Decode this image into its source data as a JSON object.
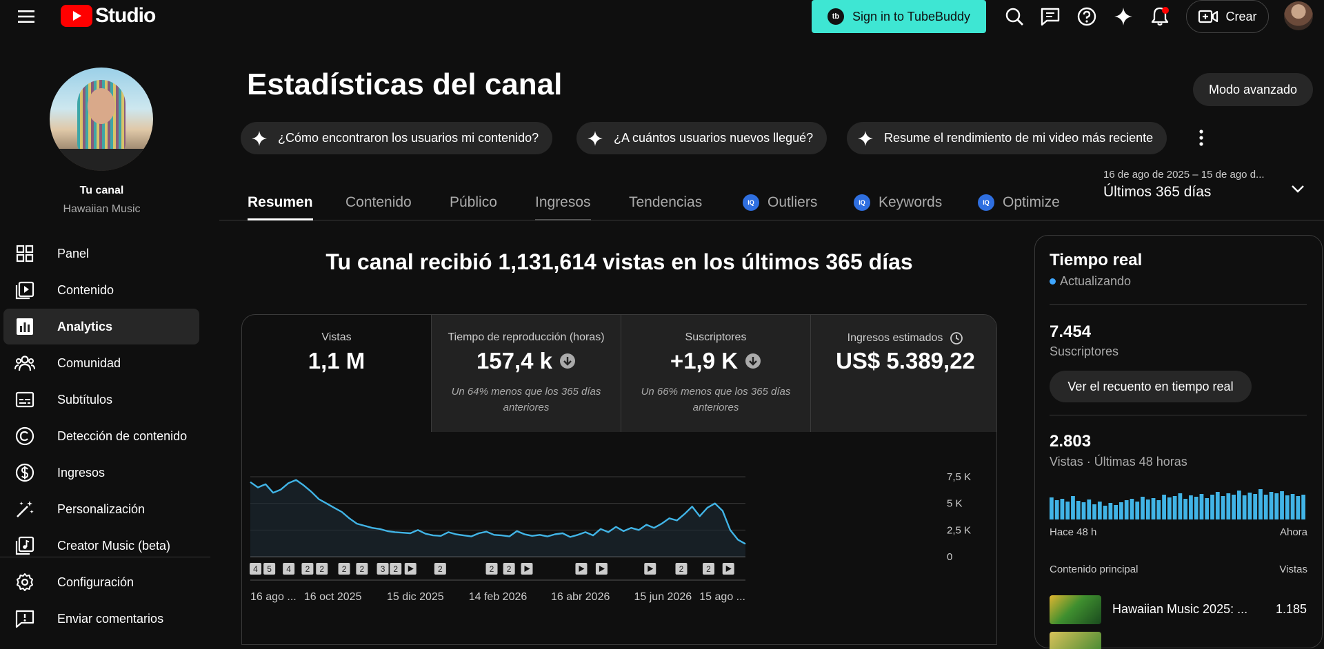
{
  "header": {
    "logo_text": "Studio",
    "tubebuddy_label": "Sign in to TubeBuddy",
    "tubebuddy_logo": "tb",
    "create_label": "Crear",
    "icons": [
      "menu-icon",
      "search-icon",
      "feedback-icon",
      "help-icon",
      "sparkle-icon",
      "bell-icon",
      "video-add-icon"
    ],
    "colors": {
      "tubebuddy": "#3ee6d3",
      "youtube_red": "#ff0000",
      "notification_dot": "#ff0000"
    }
  },
  "sidebar": {
    "channel_label": "Tu canal",
    "channel_name": "Hawaiian Music",
    "items": [
      {
        "label": "Panel",
        "icon": "dashboard-icon"
      },
      {
        "label": "Contenido",
        "icon": "content-icon"
      },
      {
        "label": "Analytics",
        "icon": "analytics-icon",
        "active": true
      },
      {
        "label": "Comunidad",
        "icon": "community-icon"
      },
      {
        "label": "Subtítulos",
        "icon": "subtitles-icon"
      },
      {
        "label": "Detección de contenido",
        "icon": "copyright-icon"
      },
      {
        "label": "Ingresos",
        "icon": "dollar-icon"
      },
      {
        "label": "Personalización",
        "icon": "magic-wand-icon"
      },
      {
        "label": "Creator Music (beta)",
        "icon": "music-icon"
      },
      {
        "label": "Configuración",
        "icon": "settings-icon"
      },
      {
        "label": "Enviar comentarios",
        "icon": "feedback-icon"
      }
    ]
  },
  "page": {
    "title": "Estadísticas del canal",
    "advanced_mode": "Modo avanzado",
    "chips": [
      "¿Cómo encontraron los usuarios mi contenido?",
      "¿A cuántos usuarios nuevos llegué?",
      "Resume el rendimiento de mi video más reciente"
    ],
    "tabs": [
      {
        "label": "Resumen",
        "active": true
      },
      {
        "label": "Contenido"
      },
      {
        "label": "Público"
      },
      {
        "label": "Ingresos"
      },
      {
        "label": "Tendencias"
      },
      {
        "label": "Outliers",
        "badge": "IQ"
      },
      {
        "label": "Keywords",
        "badge": "IQ"
      },
      {
        "label": "Optimize",
        "badge": "IQ"
      }
    ],
    "date_range_detail": "16 de ago de 2025 – 15 de ago d...",
    "date_range_label": "Últimos 365 días",
    "summary": "Tu canal recibió 1,131,614 vistas en los últimos 365 días"
  },
  "metrics": [
    {
      "label": "Vistas",
      "value": "1,1 M",
      "note": ""
    },
    {
      "label": "Tiempo de reproducción (horas)",
      "value": "157,4 k",
      "note": "Un 64% menos que los 365 días anteriores",
      "trend": "down"
    },
    {
      "label": "Suscriptores",
      "value": "+1,9 K",
      "note": "Un 66% menos que los 365 días anteriores",
      "trend": "down"
    },
    {
      "label": "Ingresos estimados",
      "value": "US$ 5.389,22",
      "note": "",
      "icon": "clock-icon"
    }
  ],
  "chart_data": {
    "type": "line",
    "series": [
      {
        "values": [
          7000,
          6500,
          6800,
          6000,
          6300,
          6900,
          7200,
          6700,
          6100,
          5400,
          5000,
          4600,
          4200,
          3600,
          3100,
          2900,
          2700,
          2600,
          2400,
          2300,
          2250,
          2200,
          2500,
          2150,
          2000,
          1950,
          2300,
          2100,
          2000,
          1900,
          2200,
          2350,
          2050,
          2000,
          1900,
          2400,
          2100,
          1950,
          2050,
          1900,
          2100,
          2200,
          1850,
          2050,
          2300,
          2000,
          2600,
          2300,
          2800,
          2400,
          2700,
          2500,
          3000,
          2700,
          3100,
          3600,
          3400,
          4000,
          4700,
          3800,
          4600,
          5000,
          4300,
          2500,
          1600,
          1200
        ]
      }
    ],
    "x_tick_labels": [
      "16 ago ...",
      "16 oct 2025",
      "15 dic 2025",
      "14 feb 2026",
      "16 abr 2026",
      "15 jun 2026",
      "15 ago ..."
    ],
    "y_tick_labels": [
      "7,5 K",
      "5 K",
      "2,5 K",
      "0"
    ],
    "ylim": [
      0,
      7500
    ],
    "grid": true,
    "line_color": "#41b4e6",
    "markers": [
      {
        "label": "4",
        "kind": "count",
        "pos": 0.007
      },
      {
        "label": "5",
        "kind": "count",
        "pos": 0.035
      },
      {
        "label": "4",
        "kind": "count",
        "pos": 0.074
      },
      {
        "label": "2",
        "kind": "count",
        "pos": 0.112
      },
      {
        "label": "2",
        "kind": "count",
        "pos": 0.141
      },
      {
        "label": "2",
        "kind": "count",
        "pos": 0.186
      },
      {
        "label": "2",
        "kind": "count",
        "pos": 0.222
      },
      {
        "label": "3",
        "kind": "count",
        "pos": 0.264
      },
      {
        "label": "2",
        "kind": "count",
        "pos": 0.29
      },
      {
        "label": "",
        "kind": "video",
        "pos": 0.32
      },
      {
        "label": "2",
        "kind": "count",
        "pos": 0.38
      },
      {
        "label": "2",
        "kind": "count",
        "pos": 0.484
      },
      {
        "label": "2",
        "kind": "count",
        "pos": 0.519
      },
      {
        "label": "",
        "kind": "video",
        "pos": 0.555
      },
      {
        "label": "",
        "kind": "video",
        "pos": 0.665
      },
      {
        "label": "",
        "kind": "video",
        "pos": 0.706
      },
      {
        "label": "",
        "kind": "video",
        "pos": 0.804
      },
      {
        "label": "2",
        "kind": "count",
        "pos": 0.867
      },
      {
        "label": "2",
        "kind": "count",
        "pos": 0.922
      },
      {
        "label": "",
        "kind": "video",
        "pos": 0.962
      }
    ]
  },
  "realtime": {
    "title": "Tiempo real",
    "status": "Actualizando",
    "subscribers_value": "7.454",
    "subscribers_label": "Suscriptores",
    "live_count_button": "Ver el recuento en tiempo real",
    "views_value": "2.803",
    "views_label": "Vistas · Últimas 48 horas",
    "bars": [
      32,
      28,
      30,
      26,
      34,
      27,
      25,
      29,
      22,
      26,
      20,
      24,
      21,
      25,
      28,
      30,
      26,
      33,
      29,
      31,
      28,
      36,
      32,
      34,
      38,
      30,
      35,
      33,
      37,
      31,
      36,
      40,
      34,
      38,
      36,
      42,
      35,
      39,
      37,
      44,
      36,
      40,
      38,
      41,
      35,
      37,
      34,
      36
    ],
    "axis_left": "Hace 48 h",
    "axis_right": "Ahora",
    "top_content_label": "Contenido principal",
    "views_col_label": "Vistas",
    "top_video_title": "Hawaiian Music 2025: ...",
    "top_video_views": "1.185",
    "bar_color": "#41b4e6"
  }
}
